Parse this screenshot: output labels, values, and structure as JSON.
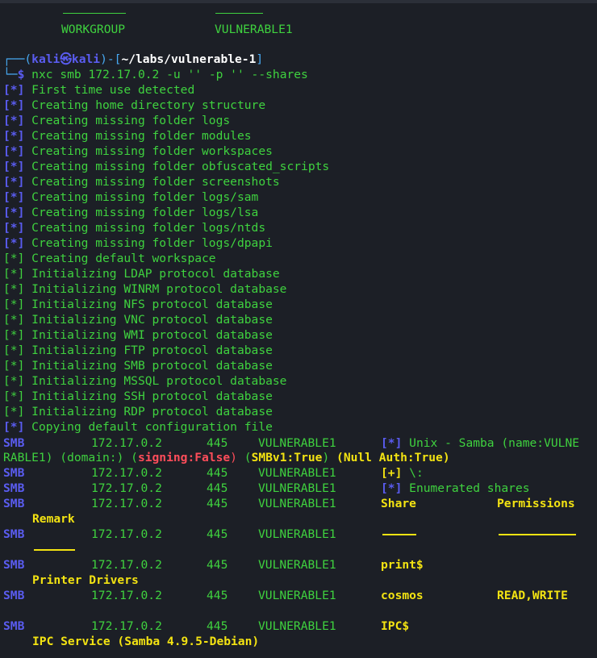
{
  "header": {
    "workgroup": "WORKGROUP",
    "host": "VULNERABLE1"
  },
  "prompt": {
    "user": "kali",
    "at": "㉿",
    "host": "kali",
    "path": "~/labs/vulnerable-1",
    "command": "nxc smb 172.17.0.2 -u '' -p '' --shares"
  },
  "log_prefix": "[*]",
  "setup_lines": [
    "First time use detected",
    "Creating home directory structure",
    "Creating missing folder logs",
    "Creating missing folder modules",
    "Creating missing folder workspaces",
    "Creating missing folder obfuscated_scripts",
    "Creating missing folder screenshots",
    "Creating missing folder logs/sam",
    "Creating missing folder logs/lsa",
    "Creating missing folder logs/ntds",
    "Creating missing folder logs/dpapi"
  ],
  "init_lines": [
    "Creating default workspace",
    "Initializing LDAP protocol database",
    "Initializing WINRM protocol database",
    "Initializing NFS protocol database",
    "Initializing VNC protocol database",
    "Initializing WMI protocol database",
    "Initializing FTP protocol database",
    "Initializing SMB protocol database",
    "Initializing MSSQL protocol database",
    "Initializing SSH protocol database",
    "Initializing RDP protocol database"
  ],
  "copy_line": "Copying default configuration file",
  "smb": {
    "proto": "SMB",
    "ip": "172.17.0.2",
    "port": "445",
    "name": "VULNERABLE1",
    "info_1": "Unix - Samba (name:VULNE",
    "info_2": "RABLE1) (domain:) (",
    "signing_label": "signing:",
    "signing_value": "False",
    "smbv1": "SMBv1:True",
    "null_auth": "(Null Auth:True)",
    "plus": "[+]",
    "root": "\\:",
    "enumerated": "Enumerated shares",
    "col_share": "Share",
    "col_perms": "Permissions",
    "col_remark": "Remark",
    "shares": [
      {
        "name": "print$",
        "perms": "",
        "remark": "Printer Drivers"
      },
      {
        "name": "cosmos",
        "perms": "READ,WRITE",
        "remark": ""
      },
      {
        "name": "IPC$",
        "perms": "",
        "remark": "IPC Service (Samba 4.9.5-Debian)"
      }
    ]
  }
}
